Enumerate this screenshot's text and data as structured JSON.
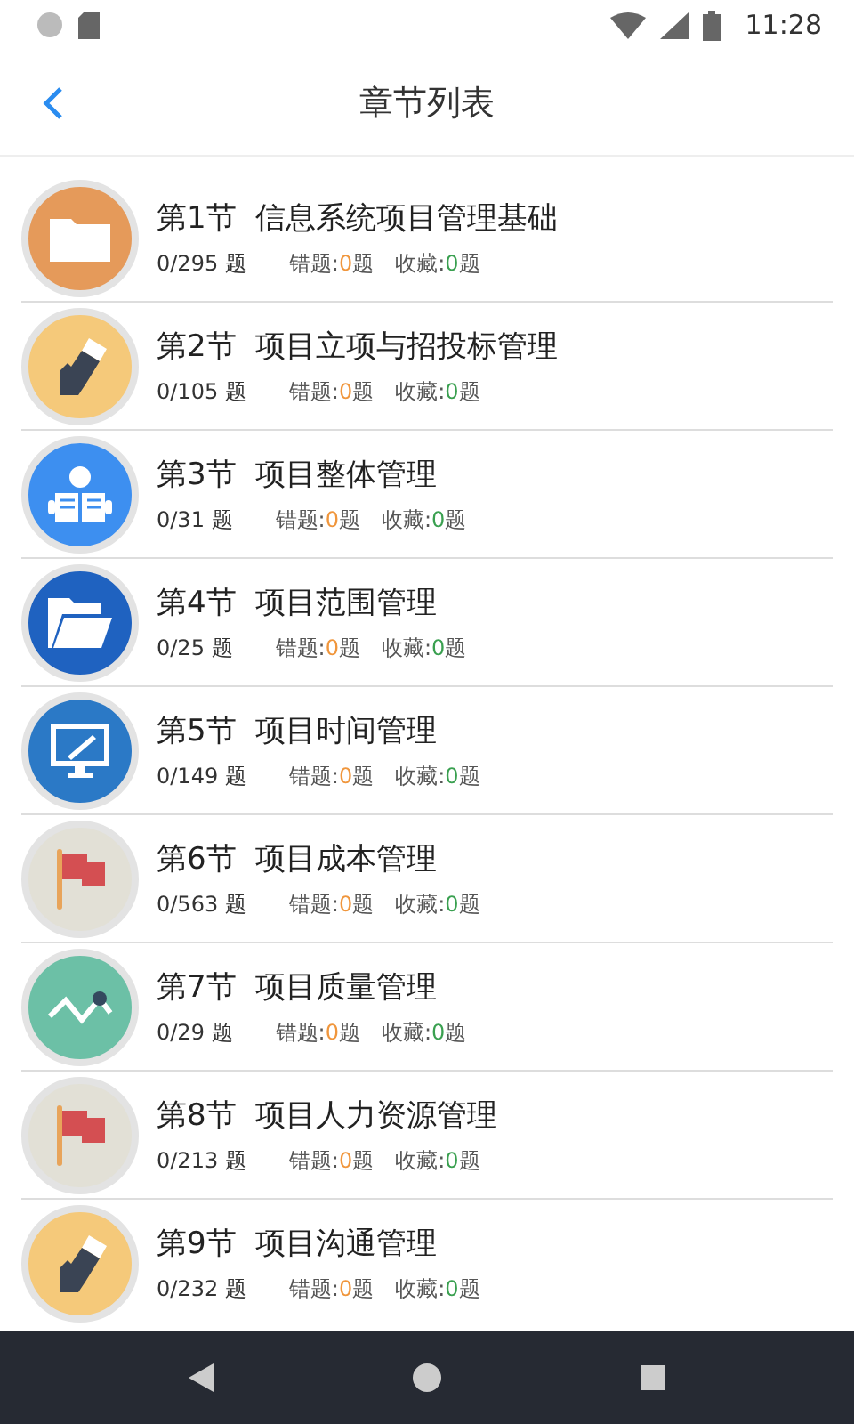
{
  "status_bar": {
    "time": "11:28"
  },
  "header": {
    "title": "章节列表"
  },
  "chapters": [
    {
      "kind": "folder",
      "color": "#e59a5a",
      "title": "第1节  信息系统项目管理基础",
      "progress": "0/295 题",
      "wrong_label": "错题:",
      "wrong_count": "0",
      "wrong_unit": "题",
      "fav_label": "收藏:",
      "fav_count": "0",
      "fav_unit": "题"
    },
    {
      "kind": "pencil",
      "color": "#f5c97a",
      "title": "第2节  项目立项与招投标管理",
      "progress": "0/105 题",
      "wrong_label": "错题:",
      "wrong_count": "0",
      "wrong_unit": "题",
      "fav_label": "收藏:",
      "fav_count": "0",
      "fav_unit": "题"
    },
    {
      "kind": "reader",
      "color": "#3d8ff0",
      "title": "第3节  项目整体管理",
      "progress": "0/31 题",
      "wrong_label": "错题:",
      "wrong_count": "0",
      "wrong_unit": "题",
      "fav_label": "收藏:",
      "fav_count": "0",
      "fav_unit": "题"
    },
    {
      "kind": "openfolder",
      "color": "#1f62c0",
      "title": "第4节  项目范围管理",
      "progress": "0/25 题",
      "wrong_label": "错题:",
      "wrong_count": "0",
      "wrong_unit": "题",
      "fav_label": "收藏:",
      "fav_count": "0",
      "fav_unit": "题"
    },
    {
      "kind": "monitor",
      "color": "#2b79c6",
      "title": "第5节  项目时间管理",
      "progress": "0/149 题",
      "wrong_label": "错题:",
      "wrong_count": "0",
      "wrong_unit": "题",
      "fav_label": "收藏:",
      "fav_count": "0",
      "fav_unit": "题"
    },
    {
      "kind": "flag",
      "color": "#e2e0d6",
      "title": "第6节  项目成本管理",
      "progress": "0/563 题",
      "wrong_label": "错题:",
      "wrong_count": "0",
      "wrong_unit": "题",
      "fav_label": "收藏:",
      "fav_count": "0",
      "fav_unit": "题"
    },
    {
      "kind": "chart",
      "color": "#6cc0a6",
      "title": "第7节  项目质量管理",
      "progress": "0/29 题",
      "wrong_label": "错题:",
      "wrong_count": "0",
      "wrong_unit": "题",
      "fav_label": "收藏:",
      "fav_count": "0",
      "fav_unit": "题"
    },
    {
      "kind": "flag",
      "color": "#e2e0d6",
      "title": "第8节  项目人力资源管理",
      "progress": "0/213 题",
      "wrong_label": "错题:",
      "wrong_count": "0",
      "wrong_unit": "题",
      "fav_label": "收藏:",
      "fav_count": "0",
      "fav_unit": "题"
    },
    {
      "kind": "pencil",
      "color": "#f5c97a",
      "title": "第9节  项目沟通管理",
      "progress": "0/232 题",
      "wrong_label": "错题:",
      "wrong_count": "0",
      "wrong_unit": "题",
      "fav_label": "收藏:",
      "fav_count": "0",
      "fav_unit": "题"
    }
  ]
}
